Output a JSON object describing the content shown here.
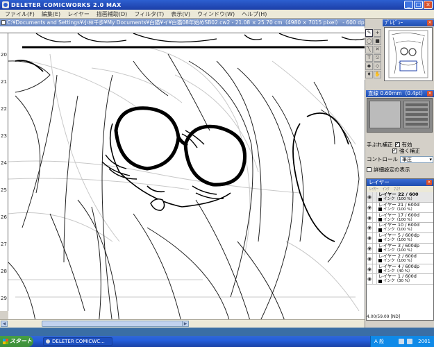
{
  "window": {
    "title": "DELETER COMICWORKS 2.0 MAX",
    "min_glyph": "_",
    "max_glyph": "□",
    "close_glyph": "×"
  },
  "menu": [
    "ファイル(F)",
    "編集(E)",
    "レイヤー",
    "描画補助(D)",
    "フィルタ(T)",
    "表示(V)",
    "ウィンドウ(W)",
    "ヘルプ(H)"
  ],
  "document": {
    "title": "C:¥Documents and Settings¥小林千歩¥My Documents¥白猫¥イ¥白猫08年始めSB02.cw2 - 21.08 × 25.70 cm（4980 × 7015 pixel） - 600 dpi - 33.3%表示",
    "ruler_numbers": [
      "20",
      "21",
      "22",
      "23",
      "24",
      "25",
      "26",
      "27",
      "28",
      "29",
      "30"
    ]
  },
  "tools": [
    "✎",
    "+",
    "◯",
    "■",
    "╲",
    "✕",
    "T",
    "⎋",
    "◆",
    "◇",
    "♦",
    "✋"
  ],
  "preview_panel": {
    "title": "ﾌﾟﾚﾋﾞｭｰ"
  },
  "brush_panel": {
    "title": "直線 0.60mm（0.4pt）"
  },
  "options": {
    "stroke_correction_label": "手ぶれ補正",
    "enabled_label": "有効",
    "strong_correction_label": "強く補正",
    "control_label": "コントロール",
    "control_value": "筆圧",
    "detail_label": "詳細設定の表示"
  },
  "layer_panel": {
    "title": "レイヤー",
    "tabs": [
      "ﾚｲﾔｰ",
      "ｲﾝｸ",
      "ﾏｽｸ"
    ],
    "header_info": "1771cm 緑 18.65cm 濃淡 10 %",
    "layers": [
      {
        "name": "レイヤー 22 / 600",
        "sub": "インク（100 %）",
        "selected": true
      },
      {
        "name": "レイヤー 21 / 600d",
        "sub": "インク（100 %）",
        "selected": false
      },
      {
        "name": "レイヤー 17 / 600d",
        "sub": "インク（100 %）",
        "selected": false
      },
      {
        "name": "レイヤー 10 / 600d",
        "sub": "インク（100 %）",
        "selected": false
      },
      {
        "name": "レイヤー 5 / 600dp",
        "sub": "インク（100 %）",
        "selected": false
      },
      {
        "name": "レイヤー 3 / 600dp",
        "sub": "インク（100 %）",
        "selected": false
      },
      {
        "name": "レイヤー 2 / 600d",
        "sub": "インク（100 %）",
        "selected": false
      },
      {
        "name": "レイヤー 4 / 600dp",
        "sub": "インク（40 %）",
        "selected": false
      },
      {
        "name": "レイヤー 1 / 600d",
        "sub": "インク（30 %）",
        "selected": false
      }
    ],
    "eye_glyph": "👁"
  },
  "status": {
    "coords": "4.00/59.09 [ND]"
  },
  "taskbar": {
    "start_label": "スタート",
    "task_label": "DELETER COMICWC...",
    "ime_label": "A 般",
    "clock": "2001"
  },
  "colors": {
    "titlebar": "#1c3fa8",
    "taskbar": "#245edb",
    "start": "#3c8e39",
    "panel_bg": "#d4d0c8"
  }
}
